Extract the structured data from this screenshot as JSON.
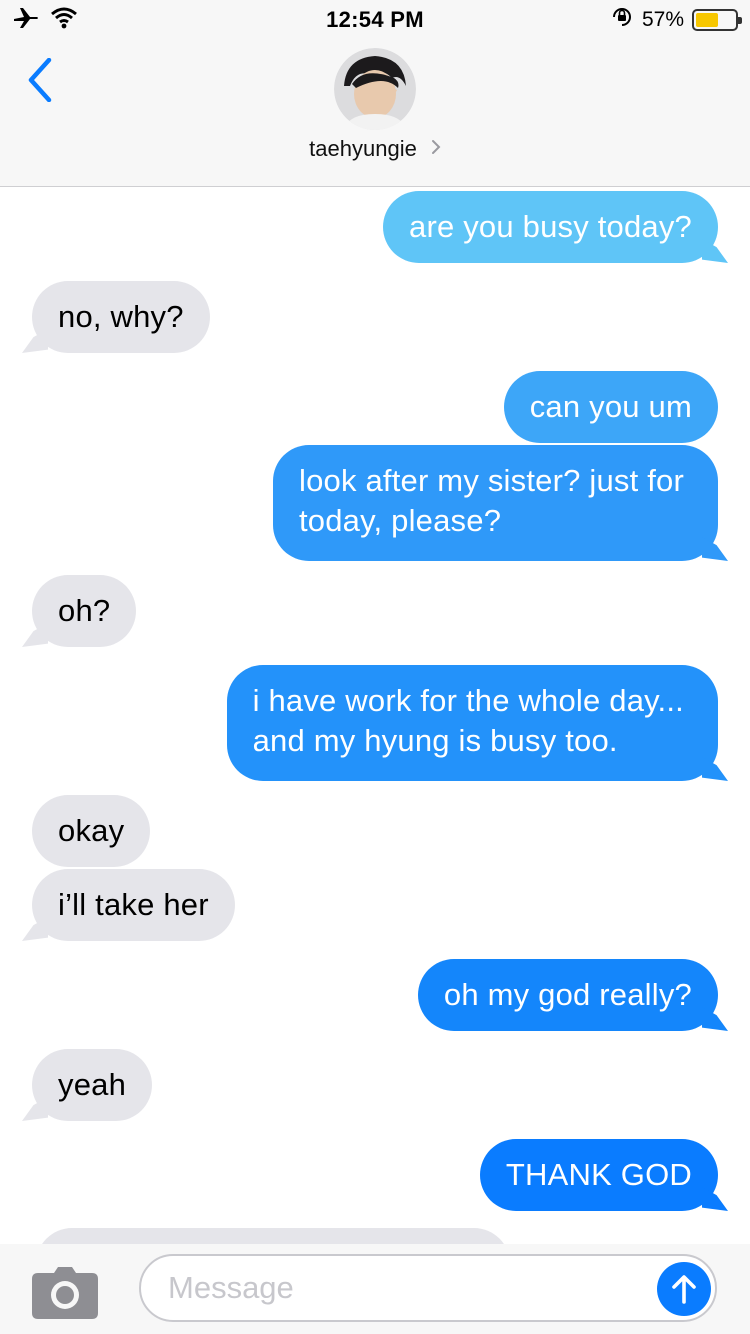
{
  "status_bar": {
    "time": "12:54 PM",
    "battery_percent_label": "57%",
    "battery_level": 0.57,
    "airplane_icon": "airplane-icon",
    "wifi_icon": "wifi-icon",
    "rotation_lock_icon": "rotation-lock-icon"
  },
  "header": {
    "contact_name": "taehyungie",
    "chevron": "›"
  },
  "messages": [
    {
      "side": "sent",
      "text": "are you busy today?"
    },
    {
      "side": "received",
      "text": "no, why?"
    },
    {
      "side": "sent",
      "text": "can you um"
    },
    {
      "side": "sent",
      "text": "look after my sister? just for\ntoday, please?"
    },
    {
      "side": "received",
      "text": "oh?"
    },
    {
      "side": "sent",
      "text": "i have work for the whole day...\nand my hyung is busy too."
    },
    {
      "side": "received",
      "text": "okay"
    },
    {
      "side": "received",
      "text": "i’ll take her"
    },
    {
      "side": "sent",
      "text": "oh my god really?"
    },
    {
      "side": "received",
      "text": "yeah"
    },
    {
      "side": "sent",
      "text": "THANK GOD"
    }
  ],
  "composer": {
    "placeholder": "Message"
  },
  "colors": {
    "sent_top": "#5ac8fa",
    "sent_bottom": "#0a7cff",
    "received": "#e5e5ea",
    "accent": "#0a7cff"
  }
}
